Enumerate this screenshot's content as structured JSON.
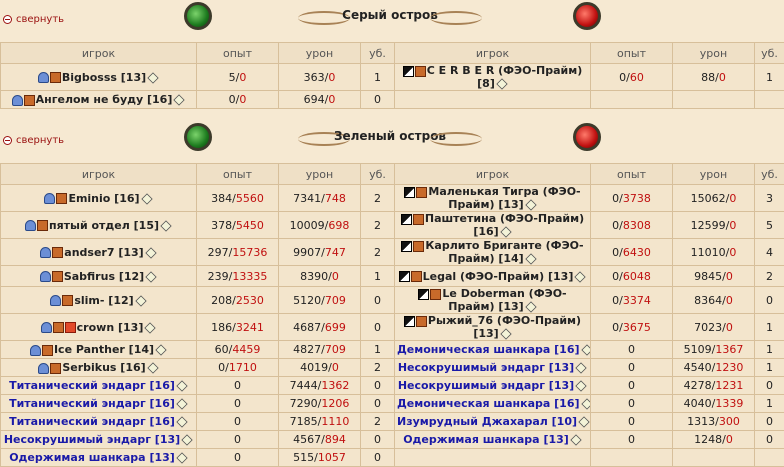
{
  "collapse_label": "свернуть",
  "headers": {
    "player": "игрок",
    "exp": "опыт",
    "damage": "урон",
    "kills": "уб."
  },
  "sections": [
    {
      "title": "Серый остров",
      "rows": [
        {
          "l_name": "Bigbosss [13]",
          "l_icons": [
            "align",
            "clan"
          ],
          "l_exp_a": "5/",
          "l_exp_b": "0",
          "l_dmg_a": "363/",
          "l_dmg_b": "0",
          "l_kills": "1",
          "r_name": "C E R B E R (ФЭО-Прайм) [8]",
          "r_icons": [
            "dark",
            "clan"
          ],
          "r_exp_a": "0/",
          "r_exp_b": "60",
          "r_dmg_a": "88/",
          "r_dmg_b": "0",
          "r_kills": "1"
        },
        {
          "l_name": "Ангелом не буду [16]",
          "l_icons": [
            "align",
            "clan"
          ],
          "l_exp_a": "0/",
          "l_exp_b": "0",
          "l_dmg_a": "694/",
          "l_dmg_b": "0",
          "l_kills": "0",
          "r_name": "",
          "r_icons": [],
          "r_exp_a": "",
          "r_exp_b": "",
          "r_dmg_a": "",
          "r_dmg_b": "",
          "r_kills": ""
        }
      ]
    },
    {
      "title": "Зеленый остров",
      "rows": [
        {
          "l_name": "Eminio [16]",
          "l_icons": [
            "align",
            "clan"
          ],
          "l_exp_a": "384/",
          "l_exp_b": "5560",
          "l_dmg_a": "7341/",
          "l_dmg_b": "748",
          "l_kills": "2",
          "r_name": "Маленькая Тигра (ФЭО-Прайм) [13]",
          "r_icons": [
            "dark",
            "clan"
          ],
          "r_exp_a": "0/",
          "r_exp_b": "3738",
          "r_dmg_a": "15062/",
          "r_dmg_b": "0",
          "r_kills": "3"
        },
        {
          "l_name": "пятый отдел [15]",
          "l_icons": [
            "align",
            "clan"
          ],
          "l_exp_a": "378/",
          "l_exp_b": "5450",
          "l_dmg_a": "10009/",
          "l_dmg_b": "698",
          "l_kills": "2",
          "r_name": "Паштетина (ФЭО-Прайм) [16]",
          "r_icons": [
            "dark",
            "clan"
          ],
          "r_exp_a": "0/",
          "r_exp_b": "8308",
          "r_dmg_a": "12599/",
          "r_dmg_b": "0",
          "r_kills": "5"
        },
        {
          "l_name": "andser7 [13]",
          "l_icons": [
            "align",
            "clan"
          ],
          "l_exp_a": "297/",
          "l_exp_b": "15736",
          "l_dmg_a": "9907/",
          "l_dmg_b": "747",
          "l_kills": "2",
          "r_name": "Карлито Бриганте (ФЭО-Прайм) [14]",
          "r_icons": [
            "dark",
            "clan"
          ],
          "r_exp_a": "0/",
          "r_exp_b": "6430",
          "r_dmg_a": "11010/",
          "r_dmg_b": "0",
          "r_kills": "4"
        },
        {
          "l_name": "Sabfirus [12]",
          "l_icons": [
            "align",
            "clan"
          ],
          "l_exp_a": "239/",
          "l_exp_b": "13335",
          "l_dmg_a": "8390/",
          "l_dmg_b": "0",
          "l_kills": "1",
          "r_name": "Legal (ФЭО-Прайм) [13]",
          "r_icons": [
            "dark",
            "clan"
          ],
          "r_exp_a": "0/",
          "r_exp_b": "6048",
          "r_dmg_a": "9845/",
          "r_dmg_b": "0",
          "r_kills": "2"
        },
        {
          "l_name": "slim- [12]",
          "l_icons": [
            "align",
            "clan"
          ],
          "l_exp_a": "208/",
          "l_exp_b": "2530",
          "l_dmg_a": "5120/",
          "l_dmg_b": "709",
          "l_kills": "0",
          "r_name": "Le Doberman (ФЭО-Прайм) [13]",
          "r_icons": [
            "dark",
            "clan"
          ],
          "r_exp_a": "0/",
          "r_exp_b": "3374",
          "r_dmg_a": "8364/",
          "r_dmg_b": "0",
          "r_kills": "0"
        },
        {
          "l_name": "crown [13]",
          "l_icons": [
            "align",
            "clan",
            "plus"
          ],
          "l_exp_a": "186/",
          "l_exp_b": "3241",
          "l_dmg_a": "4687/",
          "l_dmg_b": "699",
          "l_kills": "0",
          "r_name": "Рыжий_76 (ФЭО-Прайм) [13]",
          "r_icons": [
            "dark",
            "clan"
          ],
          "r_exp_a": "0/",
          "r_exp_b": "3675",
          "r_dmg_a": "7023/",
          "r_dmg_b": "0",
          "r_kills": "1"
        },
        {
          "l_name": "Ice Panther [14]",
          "l_icons": [
            "align",
            "clan"
          ],
          "l_exp_a": "60/",
          "l_exp_b": "4459",
          "l_dmg_a": "4827/",
          "l_dmg_b": "709",
          "l_kills": "1",
          "r_name": "Демоническая шанкара [16]",
          "r_npc": true,
          "r_icons": [],
          "r_exp_a": "0",
          "r_exp_b": "",
          "r_dmg_a": "5109/",
          "r_dmg_b": "1367",
          "r_kills": "1"
        },
        {
          "l_name": "Serbikus [16]",
          "l_icons": [
            "align",
            "clan"
          ],
          "l_exp_a": "0/",
          "l_exp_b": "1710",
          "l_dmg_a": "4019/",
          "l_dmg_b": "0",
          "l_kills": "2",
          "r_name": "Несокрушимый эндарг [13]",
          "r_npc": true,
          "r_icons": [],
          "r_exp_a": "0",
          "r_exp_b": "",
          "r_dmg_a": "4540/",
          "r_dmg_b": "1230",
          "r_kills": "1"
        },
        {
          "l_name": "Титанический эндарг [16]",
          "l_npc": true,
          "l_icons": [],
          "l_exp_a": "0",
          "l_exp_b": "",
          "l_dmg_a": "7444/",
          "l_dmg_b": "1362",
          "l_kills": "0",
          "r_name": "Несокрушимый эндарг [13]",
          "r_npc": true,
          "r_icons": [],
          "r_exp_a": "0",
          "r_exp_b": "",
          "r_dmg_a": "4278/",
          "r_dmg_b": "1231",
          "r_kills": "0"
        },
        {
          "l_name": "Титанический эндарг [16]",
          "l_npc": true,
          "l_icons": [],
          "l_exp_a": "0",
          "l_exp_b": "",
          "l_dmg_a": "7290/",
          "l_dmg_b": "1206",
          "l_kills": "0",
          "r_name": "Демоническая шанкара [16]",
          "r_npc": true,
          "r_icons": [],
          "r_exp_a": "0",
          "r_exp_b": "",
          "r_dmg_a": "4040/",
          "r_dmg_b": "1339",
          "r_kills": "1"
        },
        {
          "l_name": "Титанический эндарг [16]",
          "l_npc": true,
          "l_icons": [],
          "l_exp_a": "0",
          "l_exp_b": "",
          "l_dmg_a": "7185/",
          "l_dmg_b": "1110",
          "l_kills": "2",
          "r_name": "Изумрудный Джахарал [10]",
          "r_npc": true,
          "r_icons": [],
          "r_exp_a": "0",
          "r_exp_b": "",
          "r_dmg_a": "1313/",
          "r_dmg_b": "300",
          "r_kills": "0"
        },
        {
          "l_name": "Несокрушимый эндарг [13]",
          "l_npc": true,
          "l_icons": [],
          "l_exp_a": "0",
          "l_exp_b": "",
          "l_dmg_a": "4567/",
          "l_dmg_b": "894",
          "l_kills": "0",
          "r_name": "Одержимая шанкара [13]",
          "r_npc": true,
          "r_icons": [],
          "r_exp_a": "0",
          "r_exp_b": "",
          "r_dmg_a": "1248/",
          "r_dmg_b": "0",
          "r_kills": "0"
        },
        {
          "l_name": "Одержимая шанкара [13]",
          "l_npc": true,
          "l_icons": [],
          "l_exp_a": "0",
          "l_exp_b": "",
          "l_dmg_a": "515/",
          "l_dmg_b": "1057",
          "l_kills": "0",
          "r_name": "",
          "r_icons": [],
          "r_exp_a": "",
          "r_exp_b": "",
          "r_dmg_a": "",
          "r_dmg_b": "",
          "r_kills": ""
        }
      ]
    }
  ]
}
